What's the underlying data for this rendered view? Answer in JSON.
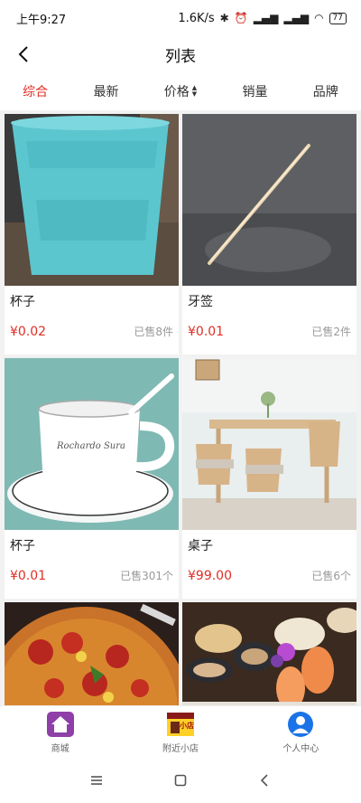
{
  "status_bar": {
    "time": "上午9:27",
    "net_speed": "1.6K/s",
    "battery": "77"
  },
  "nav": {
    "title": "列表"
  },
  "sort_tabs": [
    {
      "label": "综合",
      "active": true
    },
    {
      "label": "最新"
    },
    {
      "label": "价格"
    },
    {
      "label": "销量"
    },
    {
      "label": "品牌"
    }
  ],
  "products": [
    {
      "name": "杯子",
      "price": "¥0.02",
      "sold": "已售8件",
      "image": "blue-plastic-cup"
    },
    {
      "name": "牙签",
      "price": "¥0.01",
      "sold": "已售2件",
      "image": "toothpick"
    },
    {
      "name": "杯子",
      "price": "¥0.01",
      "sold": "已售301个",
      "image": "coffee-cup-saucer",
      "cup_print": "Rochardo Sura"
    },
    {
      "name": "桌子",
      "price": "¥99.00",
      "sold": "已售6个",
      "image": "dining-table-set"
    },
    {
      "image": "pizza"
    },
    {
      "image": "seafood-platter"
    }
  ],
  "tab_bar": [
    {
      "label": "商城",
      "icon": "home-icon",
      "color": "#8e3fa8"
    },
    {
      "label": "附近小店",
      "icon": "shop-icon",
      "badge": "小店"
    },
    {
      "label": "个人中心",
      "icon": "user-icon",
      "color": "#1a73e8"
    }
  ],
  "colors": {
    "accent": "#e02e24",
    "muted": "#999999"
  }
}
